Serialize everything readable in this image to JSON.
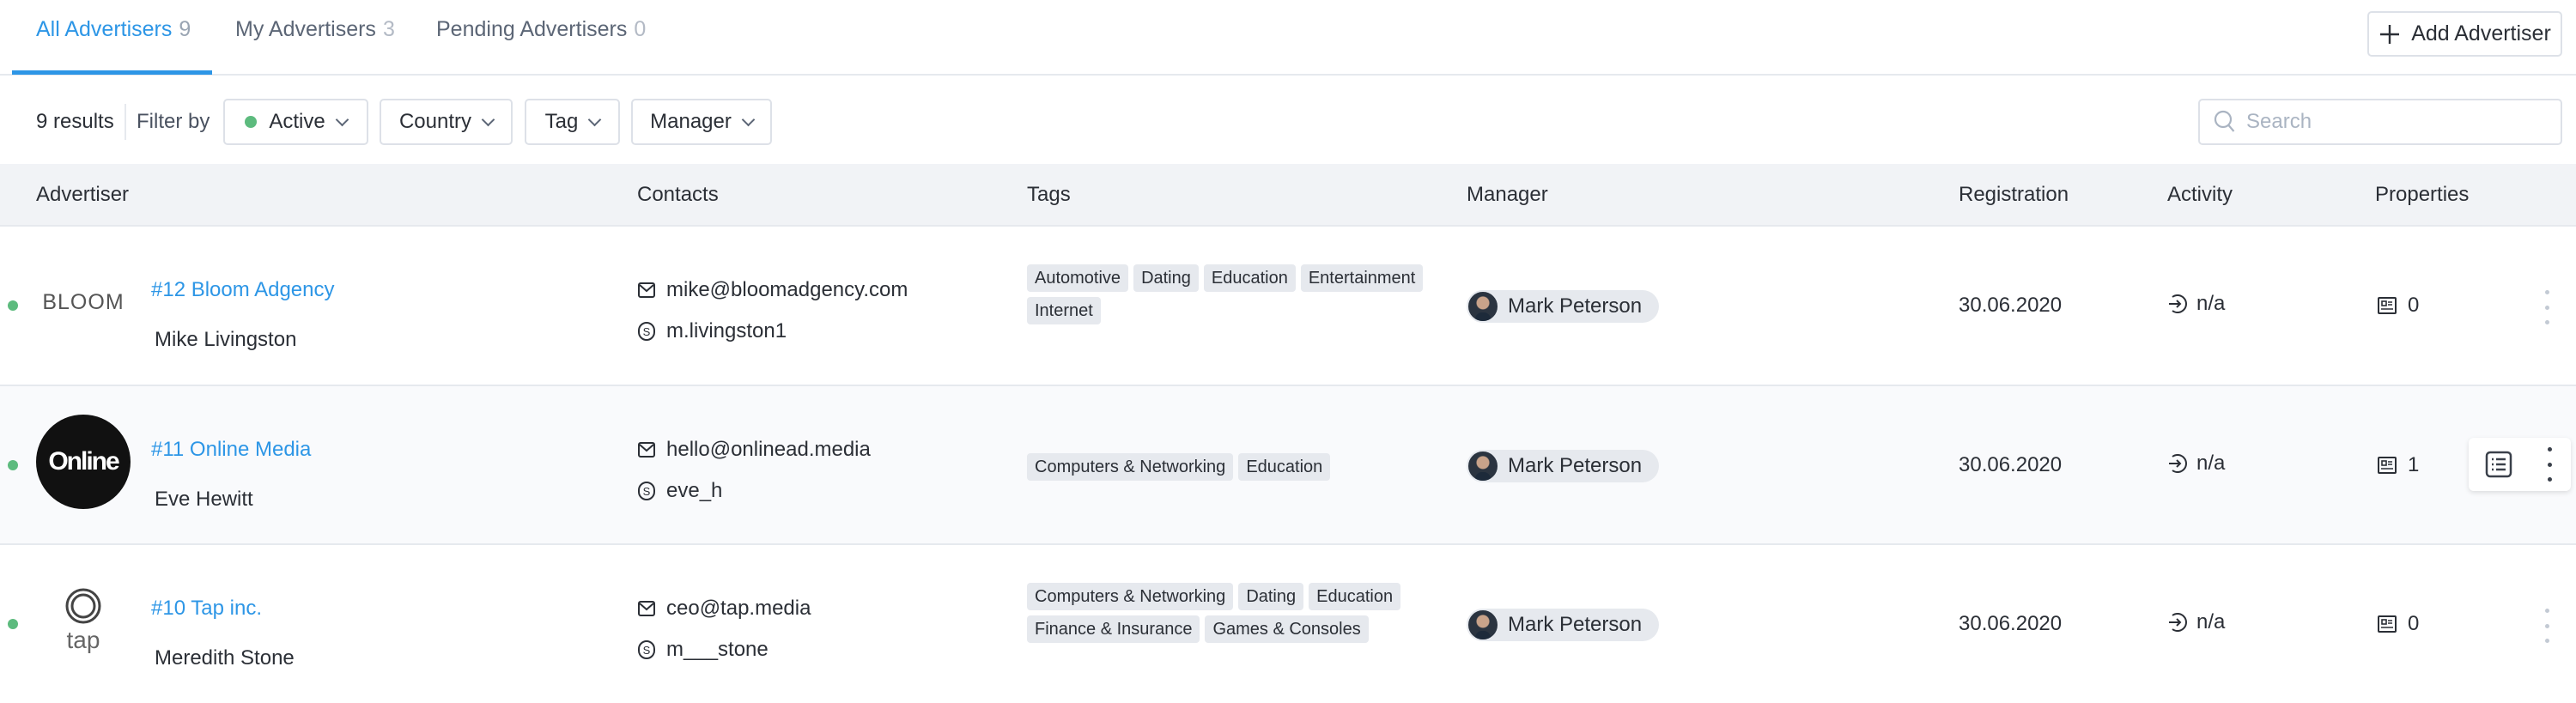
{
  "tabs": [
    {
      "label": "All Advertisers",
      "count": "9"
    },
    {
      "label": "My Advertisers",
      "count": "3"
    },
    {
      "label": "Pending Advertisers",
      "count": "0"
    }
  ],
  "add_button": "Add Advertiser",
  "filters": {
    "results": "9 results",
    "filter_by": "Filter by",
    "status": "Active",
    "country": "Country",
    "tag": "Tag",
    "manager": "Manager",
    "search_placeholder": "Search"
  },
  "columns": [
    "Advertiser",
    "Contacts",
    "Tags",
    "Manager",
    "Registration",
    "Activity",
    "Properties"
  ],
  "colors": {
    "accent": "#2d96e6",
    "active": "#5dbb7e",
    "tag_bg": "#e6e9ee",
    "header_bg": "#f1f3f6"
  },
  "rows": [
    {
      "logo": "BLOOM",
      "id_name": "#12  Bloom Adgency",
      "contact": "Mike Livingston",
      "email": "mike@bloomadgency.com",
      "skype": "m.livingston1",
      "tags": [
        "Automotive",
        "Dating",
        "Education",
        "Entertainment",
        "Internet"
      ],
      "manager": "Mark Peterson",
      "registration": "30.06.2020",
      "activity": "n/a",
      "properties": "0"
    },
    {
      "logo": "Online",
      "id_name": "#11  Online Media",
      "contact": "Eve Hewitt",
      "email": "hello@onlinead.media",
      "skype": "eve_h",
      "tags": [
        "Computers & Networking",
        "Education"
      ],
      "manager": "Mark Peterson",
      "registration": "30.06.2020",
      "activity": "n/a",
      "properties": "1"
    },
    {
      "logo": "tap",
      "id_name": "#10  Tap inc.",
      "contact": "Meredith Stone",
      "email": "ceo@tap.media",
      "skype": "m___stone",
      "tags": [
        "Computers & Networking",
        "Dating",
        "Education",
        "Finance & Insurance",
        "Games & Consoles"
      ],
      "manager": "Mark Peterson",
      "registration": "30.06.2020",
      "activity": "n/a",
      "properties": "0"
    }
  ]
}
